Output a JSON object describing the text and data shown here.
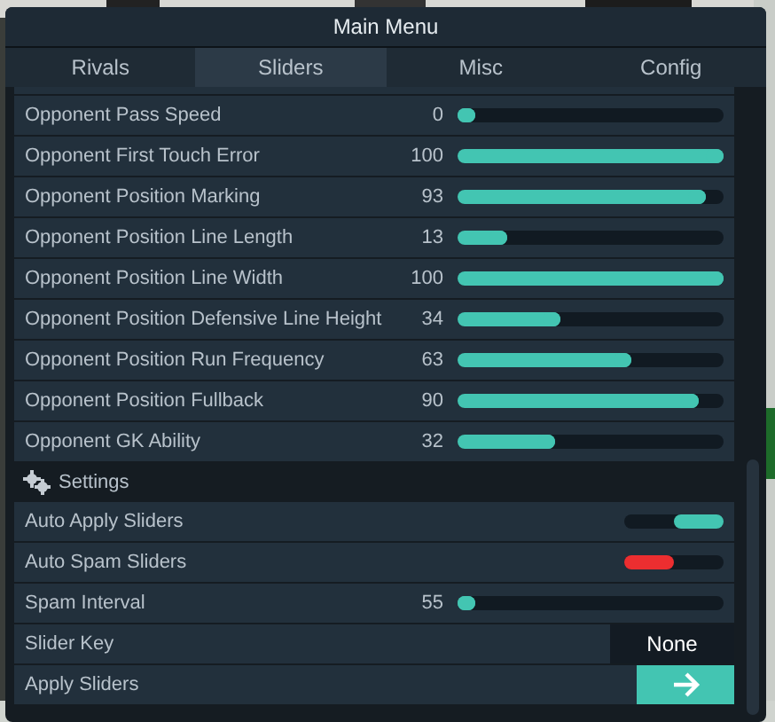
{
  "window": {
    "title": "Main Menu"
  },
  "tabs": [
    {
      "label": "Rivals",
      "selected": false
    },
    {
      "label": "Sliders",
      "selected": true
    },
    {
      "label": "Misc",
      "selected": false
    },
    {
      "label": "Config",
      "selected": false
    }
  ],
  "sliders": [
    {
      "label": "Opponent Pass Speed",
      "value": "0",
      "level": 0
    },
    {
      "label": "Opponent First Touch Error",
      "value": "100",
      "level": 1
    },
    {
      "label": "Opponent Position Marking",
      "value": "93",
      "level": 0.93
    },
    {
      "label": "Opponent Position Line Length",
      "value": "13",
      "level": 0.13
    },
    {
      "label": "Opponent Position Line Width",
      "value": "100",
      "level": 1
    },
    {
      "label": "Opponent Position Defensive Line Height",
      "value": "34",
      "level": 0.34
    },
    {
      "label": "Opponent Position Run Frequency",
      "value": "63",
      "level": 0.63
    },
    {
      "label": "Opponent Position Fullback",
      "value": "90",
      "level": 0.9
    },
    {
      "label": "Opponent GK Ability",
      "value": "32",
      "level": 0.32
    }
  ],
  "settings": {
    "title": "Settings",
    "items": [
      {
        "kind": "toggle",
        "label": "Auto Apply Sliders",
        "on": true
      },
      {
        "kind": "toggle",
        "label": "Auto Spam Sliders",
        "on": false
      },
      {
        "kind": "slider",
        "label": "Spam Interval",
        "value": "55",
        "level": 0
      },
      {
        "kind": "key",
        "label": "Slider Key",
        "value": "None"
      },
      {
        "kind": "button",
        "label": "Apply Sliders"
      }
    ]
  }
}
